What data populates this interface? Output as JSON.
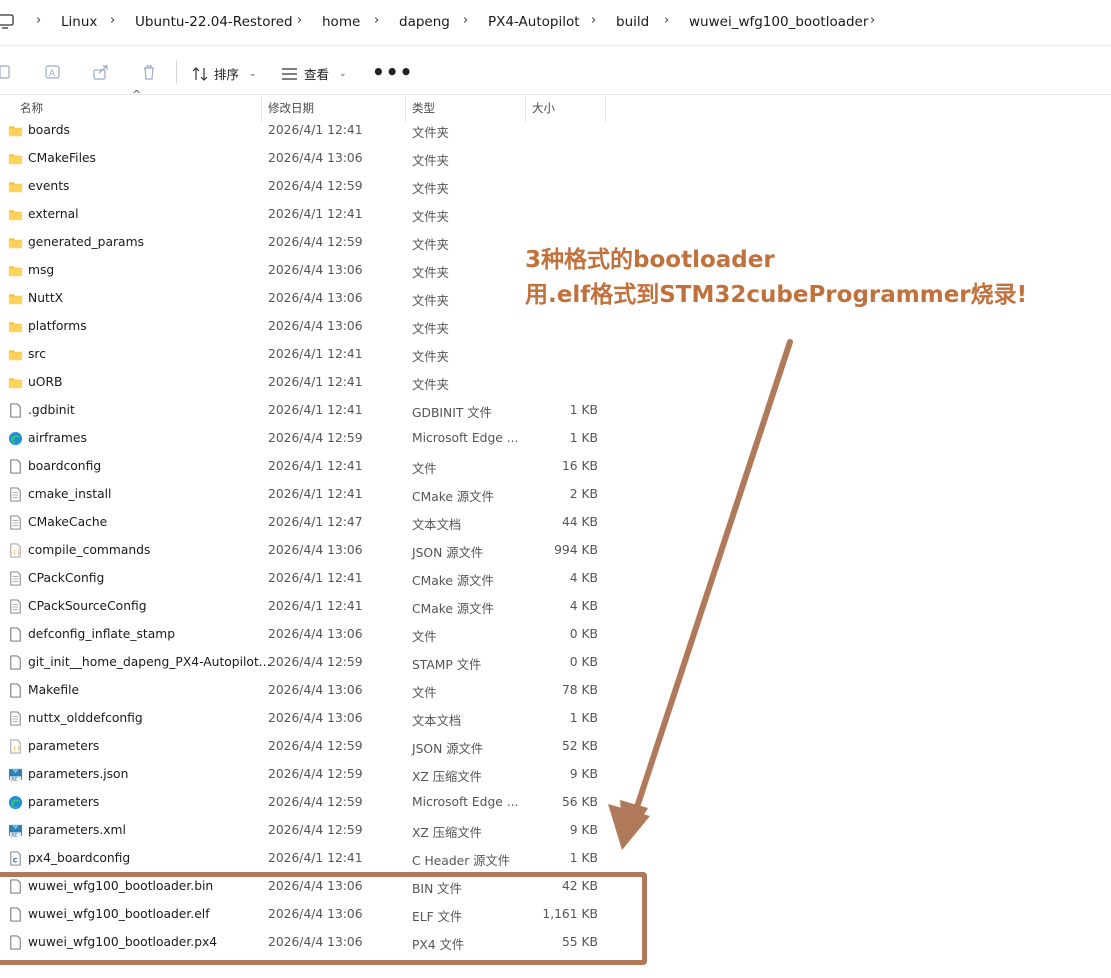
{
  "breadcrumb": [
    "Linux",
    "Ubuntu-22.04-Restored",
    "home",
    "dapeng",
    "PX4-Autopilot",
    "build",
    "wuwei_wfg100_bootloader"
  ],
  "toolbar": {
    "sort_label": "排序",
    "view_label": "查看",
    "more_label": "•••"
  },
  "columns": {
    "name": "名称",
    "date": "修改日期",
    "type": "类型",
    "size": "大小"
  },
  "files": [
    {
      "name": "boards",
      "date": "2026/4/1 12:41",
      "type": "文件夹",
      "size": "",
      "icon": "folder-icon"
    },
    {
      "name": "CMakeFiles",
      "date": "2026/4/4 13:06",
      "type": "文件夹",
      "size": "",
      "icon": "folder-icon"
    },
    {
      "name": "events",
      "date": "2026/4/4 12:59",
      "type": "文件夹",
      "size": "",
      "icon": "folder-icon"
    },
    {
      "name": "external",
      "date": "2026/4/1 12:41",
      "type": "文件夹",
      "size": "",
      "icon": "folder-icon"
    },
    {
      "name": "generated_params",
      "date": "2026/4/4 12:59",
      "type": "文件夹",
      "size": "",
      "icon": "folder-icon"
    },
    {
      "name": "msg",
      "date": "2026/4/4 13:06",
      "type": "文件夹",
      "size": "",
      "icon": "folder-icon"
    },
    {
      "name": "NuttX",
      "date": "2026/4/4 13:06",
      "type": "文件夹",
      "size": "",
      "icon": "folder-icon"
    },
    {
      "name": "platforms",
      "date": "2026/4/4 13:06",
      "type": "文件夹",
      "size": "",
      "icon": "folder-icon"
    },
    {
      "name": "src",
      "date": "2026/4/1 12:41",
      "type": "文件夹",
      "size": "",
      "icon": "folder-icon"
    },
    {
      "name": "uORB",
      "date": "2026/4/1 12:41",
      "type": "文件夹",
      "size": "",
      "icon": "folder-icon"
    },
    {
      "name": ".gdbinit",
      "date": "2026/4/1 12:41",
      "type": "GDBINIT 文件",
      "size": "1 KB",
      "icon": "file-icon"
    },
    {
      "name": "airframes",
      "date": "2026/4/4 12:59",
      "type": "Microsoft Edge ...",
      "size": "1 KB",
      "icon": "edge-icon"
    },
    {
      "name": "boardconfig",
      "date": "2026/4/1 12:41",
      "type": "文件",
      "size": "16 KB",
      "icon": "file-icon"
    },
    {
      "name": "cmake_install",
      "date": "2026/4/1 12:41",
      "type": "CMake 源文件",
      "size": "2 KB",
      "icon": "text-file-icon"
    },
    {
      "name": "CMakeCache",
      "date": "2026/4/1 12:47",
      "type": "文本文档",
      "size": "44 KB",
      "icon": "text-file-icon"
    },
    {
      "name": "compile_commands",
      "date": "2026/4/4 13:06",
      "type": "JSON 源文件",
      "size": "994 KB",
      "icon": "json-file-icon"
    },
    {
      "name": "CPackConfig",
      "date": "2026/4/1 12:41",
      "type": "CMake 源文件",
      "size": "4 KB",
      "icon": "text-file-icon"
    },
    {
      "name": "CPackSourceConfig",
      "date": "2026/4/1 12:41",
      "type": "CMake 源文件",
      "size": "4 KB",
      "icon": "text-file-icon"
    },
    {
      "name": "defconfig_inflate_stamp",
      "date": "2026/4/4 13:06",
      "type": "文件",
      "size": "0 KB",
      "icon": "file-icon"
    },
    {
      "name": "git_init__home_dapeng_PX4-Autopilot...",
      "date": "2026/4/4 12:59",
      "type": "STAMP 文件",
      "size": "0 KB",
      "icon": "file-icon"
    },
    {
      "name": "Makefile",
      "date": "2026/4/4 13:06",
      "type": "文件",
      "size": "78 KB",
      "icon": "file-icon"
    },
    {
      "name": "nuttx_olddefconfig",
      "date": "2026/4/4 13:06",
      "type": "文本文档",
      "size": "1 KB",
      "icon": "text-file-icon"
    },
    {
      "name": "parameters",
      "date": "2026/4/4 12:59",
      "type": "JSON 源文件",
      "size": "52 KB",
      "icon": "json-file-icon"
    },
    {
      "name": "parameters.json",
      "date": "2026/4/4 12:59",
      "type": "XZ 压缩文件",
      "size": "9 KB",
      "icon": "xz-archive-icon"
    },
    {
      "name": "parameters",
      "date": "2026/4/4 12:59",
      "type": "Microsoft Edge ...",
      "size": "56 KB",
      "icon": "edge-icon"
    },
    {
      "name": "parameters.xml",
      "date": "2026/4/4 12:59",
      "type": "XZ 压缩文件",
      "size": "9 KB",
      "icon": "xz-archive-icon"
    },
    {
      "name": "px4_boardconfig",
      "date": "2026/4/1 12:41",
      "type": "C Header 源文件",
      "size": "1 KB",
      "icon": "c-header-icon"
    },
    {
      "name": "wuwei_wfg100_bootloader.bin",
      "date": "2026/4/4 13:06",
      "type": "BIN 文件",
      "size": "42 KB",
      "icon": "file-icon"
    },
    {
      "name": "wuwei_wfg100_bootloader.elf",
      "date": "2026/4/4 13:06",
      "type": "ELF 文件",
      "size": "1,161 KB",
      "icon": "file-icon"
    },
    {
      "name": "wuwei_wfg100_bootloader.px4",
      "date": "2026/4/4 13:06",
      "type": "PX4 文件",
      "size": "55 KB",
      "icon": "file-icon"
    }
  ],
  "annotation": {
    "line1": "3种格式的bootloader",
    "line2": "用.elf格式到STM32cubeProgrammer烧录!",
    "color": "#c0713c",
    "box_color": "#b07a5a"
  }
}
